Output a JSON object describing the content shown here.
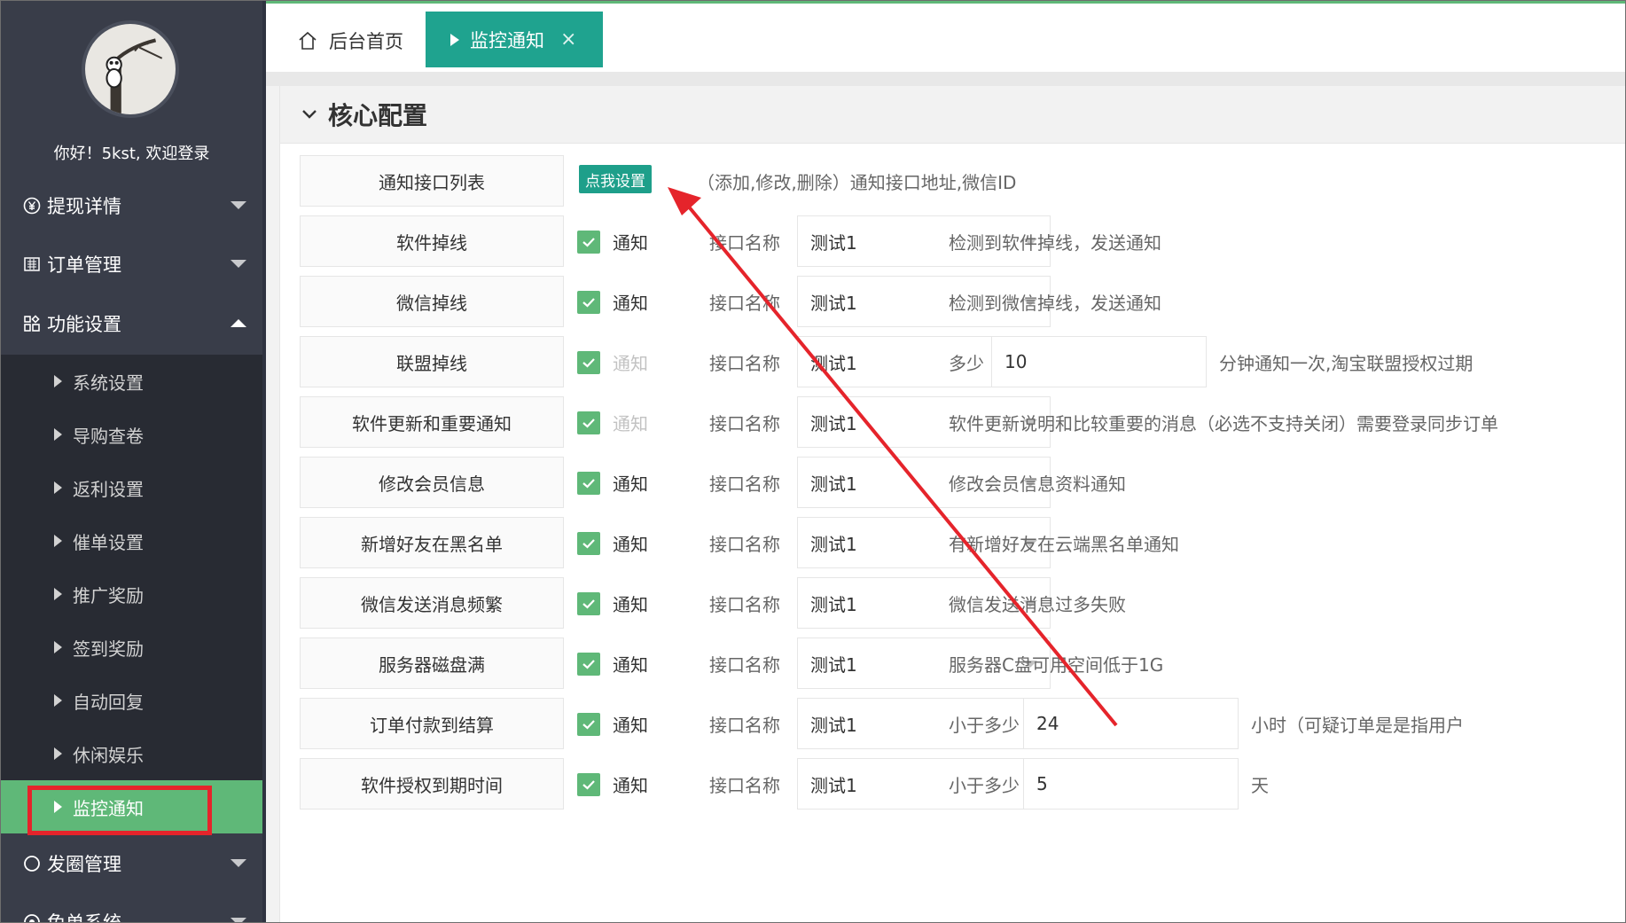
{
  "user": {
    "greeting": "你好！5kst, 欢迎登录"
  },
  "sidebar": {
    "menus": [
      {
        "label": "提现详情",
        "icon": "yen-icon"
      },
      {
        "label": "订单管理",
        "icon": "list-icon"
      },
      {
        "label": "功能设置",
        "icon": "grid-icon"
      },
      {
        "label": "发圈管理",
        "icon": "circle-icon"
      },
      {
        "label": "免单系统",
        "icon": "gift-icon"
      }
    ],
    "submenu": [
      "系统设置",
      "导购查卷",
      "返利设置",
      "催单设置",
      "推广奖励",
      "签到奖励",
      "自动回复",
      "休闲娱乐",
      "监控通知"
    ],
    "active_sub": "监控通知"
  },
  "tabs": {
    "home": "后台首页",
    "active": "监控通知",
    "close": "×"
  },
  "panel": {
    "title": "核心配置",
    "first_row": {
      "label": "通知接口列表",
      "button": "点我设置",
      "desc": "（添加,修改,删除）通知接口地址,微信ID"
    },
    "common": {
      "check_label": "通知",
      "iface_label": "接口名称",
      "select_value": "测试1"
    },
    "rows": [
      {
        "label": "软件掉线",
        "checked": true,
        "check_disabled": false,
        "desc": "检测到软件掉线，发送通知"
      },
      {
        "label": "微信掉线",
        "checked": true,
        "check_disabled": false,
        "desc": "检测到微信掉线，发送通知"
      },
      {
        "label": "联盟掉线",
        "checked": true,
        "check_disabled": true,
        "extra_label": "多少",
        "input": "10",
        "desc": "分钟通知一次,淘宝联盟授权过期"
      },
      {
        "label": "软件更新和重要通知",
        "checked": true,
        "check_disabled": true,
        "desc": "软件更新说明和比较重要的消息（必选不支持关闭）需要登录同步订单"
      },
      {
        "label": "修改会员信息",
        "checked": true,
        "check_disabled": false,
        "desc": "修改会员信息资料通知"
      },
      {
        "label": "新增好友在黑名单",
        "checked": true,
        "check_disabled": false,
        "desc": "有新增好友在云端黑名单通知"
      },
      {
        "label": "微信发送消息频繁",
        "checked": true,
        "check_disabled": false,
        "desc": "微信发送消息过多失败"
      },
      {
        "label": "服务器磁盘满",
        "checked": true,
        "check_disabled": false,
        "desc": "服务器C盘可用空间低于1G"
      },
      {
        "label": "订单付款到结算",
        "checked": true,
        "check_disabled": false,
        "extra_label": "小于多少",
        "input": "24",
        "desc": "小时（可疑订单是是指用户"
      },
      {
        "label": "软件授权到期时间",
        "checked": true,
        "check_disabled": false,
        "extra_label": "小于多少",
        "input": "5",
        "desc": "天"
      }
    ]
  },
  "colors": {
    "sidebar_bg": "#393d49",
    "submenu_bg": "#282b33",
    "active_green": "#5fb878",
    "tab_teal": "#1fa38f",
    "annotation_red": "#e5242b"
  }
}
